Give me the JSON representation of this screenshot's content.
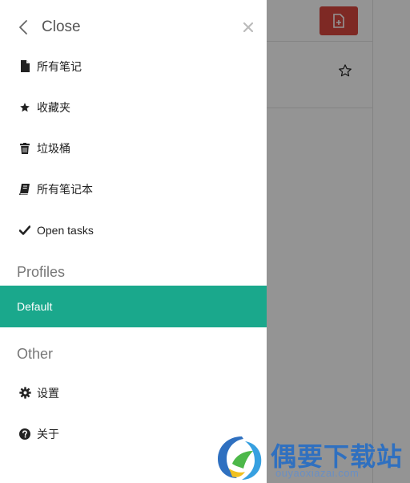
{
  "drawer": {
    "close_label": "Close",
    "items": [
      {
        "label": "所有笔记",
        "icon": "document-icon"
      },
      {
        "label": "收藏夹",
        "icon": "star-icon"
      },
      {
        "label": "垃圾桶",
        "icon": "trash-icon"
      },
      {
        "label": "所有笔记本",
        "icon": "notebook-icon"
      },
      {
        "label": "Open tasks",
        "icon": "check-icon"
      }
    ],
    "profiles_title": "Profiles",
    "profiles": [
      {
        "label": "Default",
        "selected": true
      }
    ],
    "other_title": "Other",
    "other_items": [
      {
        "label": "设置",
        "icon": "gear-icon"
      },
      {
        "label": "关于",
        "icon": "question-icon"
      }
    ]
  },
  "background": {
    "new_note_icon": "new-note-icon",
    "star_icon": "star-outline-icon"
  },
  "watermark": {
    "name": "偶要下载站",
    "url": "ouyaoxiazai.com"
  },
  "colors": {
    "accent": "#1aa88c",
    "new_note": "#d9473f",
    "overlay": "rgba(0,0,0,0.42)",
    "watermark": "#2f70c0"
  }
}
